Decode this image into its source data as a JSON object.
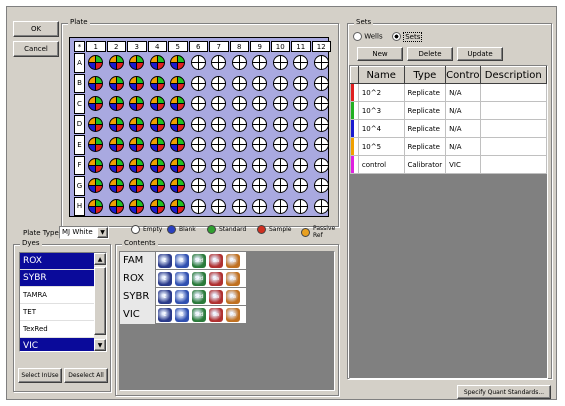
{
  "buttons": {
    "ok": "OK",
    "cancel": "Cancel",
    "new": "New",
    "delete": "Delete",
    "update": "Update",
    "select_in_use": "Select InUse",
    "deselect_all": "Deselect All",
    "specify": "Specify Quant Standards..."
  },
  "plate": {
    "label": "Plate",
    "corner": "*",
    "columns": [
      "1",
      "2",
      "3",
      "4",
      "5",
      "6",
      "7",
      "8",
      "9",
      "10",
      "11",
      "12"
    ],
    "rows": [
      "A",
      "B",
      "C",
      "D",
      "E",
      "F",
      "G",
      "H"
    ],
    "filled_columns": 5
  },
  "plate_type": {
    "label": "Plate Type:",
    "value": "MJ White"
  },
  "legend": [
    {
      "label": "Empty",
      "color": "#ffffff"
    },
    {
      "label": "Blank",
      "color": "#2a40c0"
    },
    {
      "label": "Standard",
      "color": "#30a030"
    },
    {
      "label": "Sample",
      "color": "#d03020"
    },
    {
      "label": "Passive Ref",
      "color": "#e8a020"
    }
  ],
  "dyes": {
    "label": "Dyes",
    "items": [
      {
        "name": "ROX",
        "selected": true
      },
      {
        "name": "SYBR",
        "selected": true
      },
      {
        "name": "TAMRA",
        "selected": false
      },
      {
        "name": "TET",
        "selected": false
      },
      {
        "name": "TexRed",
        "selected": false
      },
      {
        "name": "VIC",
        "selected": true
      }
    ]
  },
  "contents": {
    "label": "Contents",
    "rows": [
      "FAM",
      "ROX",
      "SYBR",
      "VIC"
    ],
    "icons": [
      {
        "text": "E",
        "color": "#2a3a8a"
      },
      {
        "text": "B",
        "color": "#3050b0"
      },
      {
        "text": "Std",
        "color": "#2a7a3a"
      },
      {
        "text": "Sa",
        "color": "#b03030"
      },
      {
        "text": "Pa",
        "color": "#c07020"
      }
    ]
  },
  "sets": {
    "label": "Sets",
    "radio_wells": "Wells",
    "radio_sets": "Sets",
    "selected_radio": "Sets",
    "columns": [
      "Name",
      "Type",
      "Contro",
      "Description"
    ],
    "rows": [
      {
        "color": "#e02020",
        "name": "10^2",
        "type": "Replicate",
        "control": "N/A",
        "description": ""
      },
      {
        "color": "#22b022",
        "name": "10^3",
        "type": "Replicate",
        "control": "N/A",
        "description": ""
      },
      {
        "color": "#1a1ad0",
        "name": "10^4",
        "type": "Replicate",
        "control": "N/A",
        "description": ""
      },
      {
        "color": "#f0a000",
        "name": "10^5",
        "type": "Replicate",
        "control": "N/A",
        "description": ""
      },
      {
        "color": "#e020e0",
        "name": "control",
        "type": "Calibrator",
        "control": "VIC",
        "description": ""
      }
    ]
  }
}
